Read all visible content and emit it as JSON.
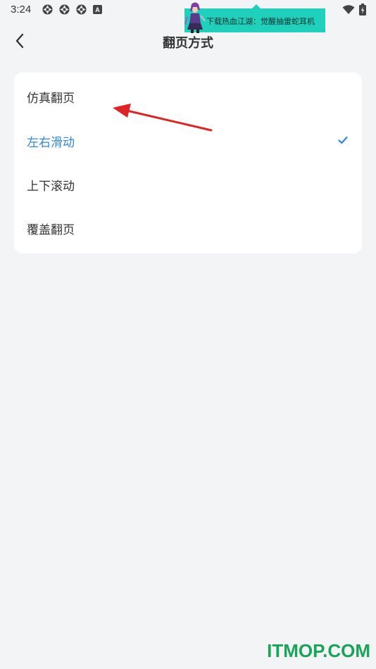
{
  "status_bar": {
    "time": "3:24",
    "left_icons": [
      "aperture-icon",
      "aperture-icon",
      "aperture-icon",
      "a-badge-icon"
    ],
    "right_icons": [
      "wifi-icon",
      "battery-charging-icon"
    ],
    "a_badge": "A"
  },
  "banner": {
    "text": "下载热血江湖：觉醒抽雷蛇耳机",
    "color": "#1fd1bd"
  },
  "header": {
    "title": "翻页方式",
    "back_icon": "chevron-left-icon"
  },
  "options": [
    {
      "label": "仿真翻页",
      "selected": false
    },
    {
      "label": "左右滑动",
      "selected": true
    },
    {
      "label": "上下滚动",
      "selected": false
    },
    {
      "label": "覆盖翻页",
      "selected": false
    }
  ],
  "colors": {
    "accent": "#2f86e6",
    "background": "#f3f4f6",
    "card": "#ffffff",
    "annotation_arrow": "#e02424",
    "watermark": "#18a558"
  },
  "watermark": "ITMOP.COM"
}
